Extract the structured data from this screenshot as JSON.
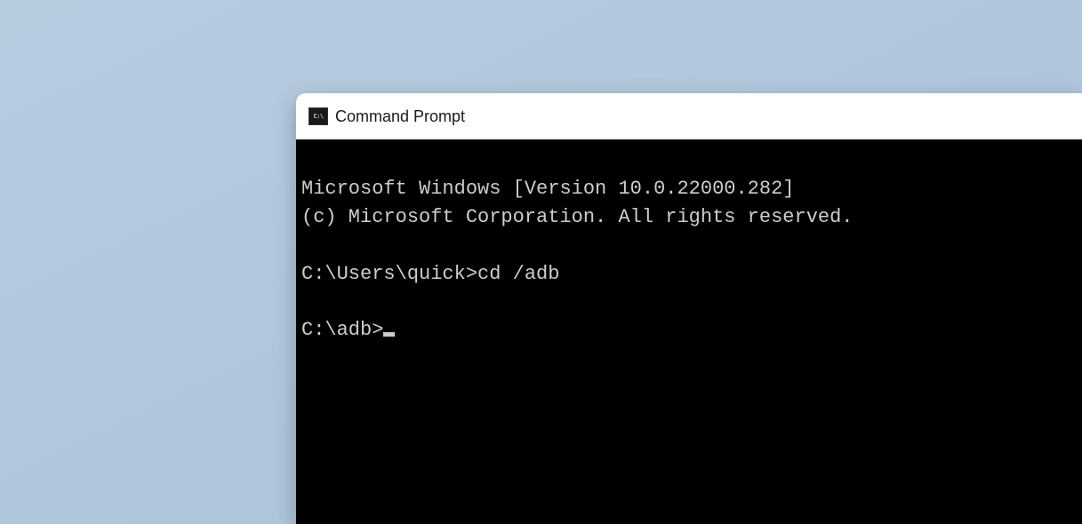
{
  "window": {
    "title": "Command Prompt",
    "icon_label": "C:\\"
  },
  "terminal": {
    "line1": "Microsoft Windows [Version 10.0.22000.282]",
    "line2": "(c) Microsoft Corporation. All rights reserved.",
    "blank1": "",
    "prompt1": "C:\\Users\\quick>",
    "command1": "cd /adb",
    "blank2": "",
    "prompt2": "C:\\adb>"
  }
}
